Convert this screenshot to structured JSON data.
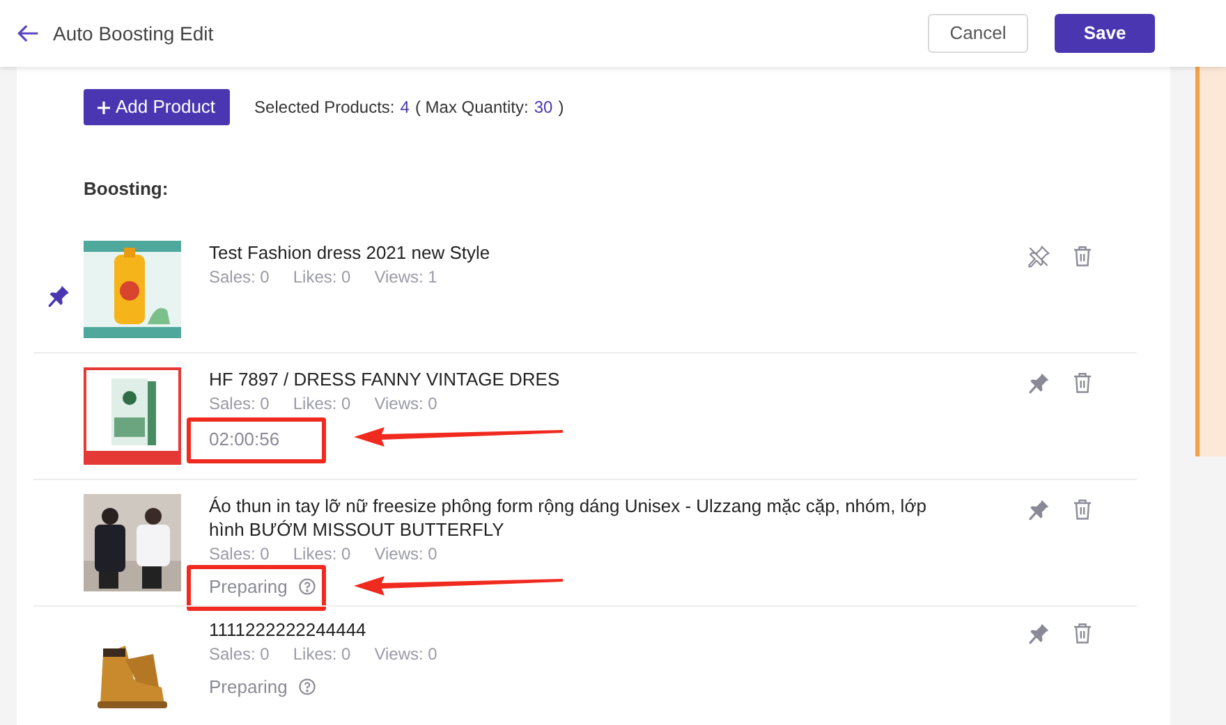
{
  "header": {
    "title": "Auto Boosting Edit",
    "buttons": [
      {
        "label": "Cancel",
        "kind": "secondary"
      },
      {
        "label": "Save",
        "kind": "primary"
      }
    ]
  },
  "toolbar": {
    "add_button": "Add Product",
    "summary_label": "Selected Products:",
    "selected_count": "4",
    "max_label": "( Max Quantity:",
    "max_count": "30",
    "max_close": ")"
  },
  "section_title": "Boosting:",
  "products": [
    {
      "name": "Test Fashion dress 2021 new Style",
      "sales": "Sales: 0",
      "likes": "Likes: 0",
      "views": "Views: 1",
      "pinned": true,
      "highlighted": false
    },
    {
      "name": "HF 7897 / DRESS FANNY VINTAGE DRES",
      "sales": "Sales: 0",
      "likes": "Likes: 0",
      "views": "Views: 0",
      "pinned": false,
      "status": {
        "kind": "timer",
        "text": "02:00:56"
      },
      "highlighted": true
    },
    {
      "name": "Áo thun in tay lỡ nữ freesize phông form rộng dáng Unisex - Ulzzang mặc cặp, nhóm, lớp hình BƯỚM MISSOUT BUTTERFLY",
      "sales": "Sales: 0",
      "likes": "Likes: 0",
      "views": "Views: 0",
      "pinned": false,
      "status": {
        "kind": "preparing",
        "text": "Preparing"
      },
      "highlighted": true
    },
    {
      "name": "1111222222244444",
      "sales": "Sales: 0",
      "likes": "Likes: 0",
      "views": "Views: 0",
      "pinned": false,
      "status": {
        "kind": "preparing",
        "text": "Preparing"
      },
      "highlighted": false
    }
  ]
}
